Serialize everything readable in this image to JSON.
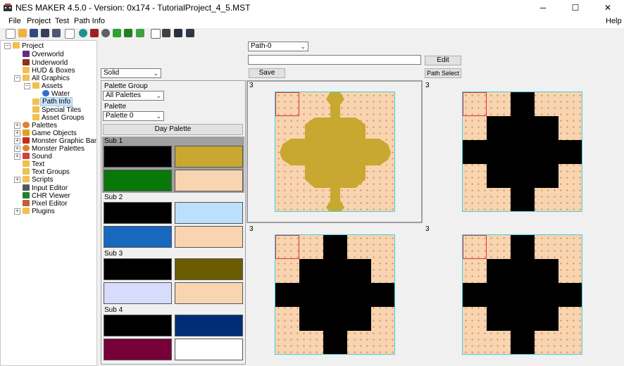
{
  "window": {
    "title": "NES MAKER 4.5.0 - Version: 0x174 - TutorialProject_4_5.MST",
    "minimize": "─",
    "maximize": "☐",
    "close": "✕"
  },
  "menu": {
    "file": "File",
    "project": "Project",
    "test": "Test",
    "path_info": "Path Info",
    "help": "Help"
  },
  "toolbar": {
    "icons": [
      "new-icon",
      "open-icon",
      "save-icon",
      "save-as-icon",
      "export-icon",
      "globe-icon",
      "build-icon",
      "settings-icon",
      "run-icon",
      "emulator-icon",
      "debug-icon",
      "screen-icon",
      "monitor-icon",
      "book-icon"
    ]
  },
  "tree": {
    "project": "Project",
    "overworld": "Overworld",
    "underworld": "Underworld",
    "hud_boxes": "HUD & Boxes",
    "all_graphics": "All Graphics",
    "assets": "Assets",
    "water": "Water",
    "path_info": "Path Info",
    "special_tiles": "Special Tiles",
    "asset_groups": "Asset Groups",
    "palettes": "Palettes",
    "game_objects": "Game Objects",
    "monster_graphic_banks": "Monster Graphic Banks",
    "monster_palettes": "Monster Palettes",
    "sound": "Sound",
    "text": "Text",
    "text_groups": "Text Groups",
    "scripts": "Scripts",
    "input_editor": "Input Editor",
    "chr_viewer": "CHR Viewer",
    "pixel_editor": "Pixel Editor",
    "plugins": "Plugins"
  },
  "controls": {
    "path_select_value": "Path-0",
    "path_name_value": "",
    "edit_label": "Edit",
    "draw_mode_value": "Solid",
    "save_label": "Save",
    "path_select_button": "Path Select"
  },
  "palette_panel": {
    "group_label": "Palette Group",
    "group_value": "All Palettes",
    "palette_label": "Palette",
    "palette_value": "Palette 0",
    "day_palette_button": "Day Palette",
    "subs": [
      {
        "label": "Sub 1",
        "colors": [
          "#000000",
          "#c8a830",
          "#087808",
          "#f8d4b0"
        ]
      },
      {
        "label": "Sub 2",
        "colors": [
          "#000000",
          "#bce0fc",
          "#1868c0",
          "#f8d4b0"
        ]
      },
      {
        "label": "Sub 3",
        "colors": [
          "#000000",
          "#6c5c00",
          "#d8dcfc",
          "#f8d4b0"
        ]
      },
      {
        "label": "Sub 4",
        "colors": [
          "#000000",
          "#002c78",
          "#780038",
          "#ffffff"
        ]
      }
    ]
  },
  "tiles": {
    "labels": [
      "3",
      "3",
      "3",
      "3"
    ],
    "fill_colors": [
      "#c8a830",
      "#000000",
      "#000000",
      "#000000"
    ]
  }
}
